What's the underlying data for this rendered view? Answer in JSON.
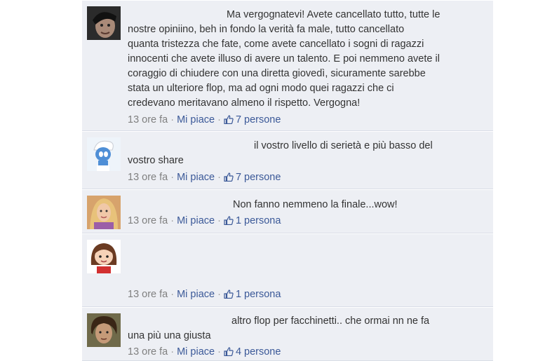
{
  "comments": [
    {
      "avatar": "avatar-man-dark-hair",
      "lines": [
        "Ma vergognatevi! Avete cancellato tutto, tutte le",
        "nostre opiniino, beh in fondo la verità fa male, tutto cancellato",
        "quanta tristezza che fate, come avete cancellato i sogni di ragazzi",
        "innocenti che avete illuso di avere un talento. E poi nemmeno avete il",
        "coraggio di chiudere con una diretta giovedì, sicuramente sarebbe",
        "stata un ulteriore flop, ma ad ogni modo quei ragazzi che ci",
        "credevano meritavano almeno il rispetto. Vergogna!"
      ],
      "time": "13 ore fa",
      "like_label": "Mi piace",
      "likes": "7 persone"
    },
    {
      "avatar": "avatar-smurf",
      "lines": [
        "il vostro livello di serietà e più basso del",
        "vostro share"
      ],
      "time": "13 ore fa",
      "like_label": "Mi piace",
      "likes": "7 persone"
    },
    {
      "avatar": "avatar-blonde-woman",
      "lines": [
        "Non fanno nemmeno la finale...wow!"
      ],
      "time": "13 ore fa",
      "like_label": "Mi piace",
      "likes": "1 persona"
    },
    {
      "avatar": "avatar-cartoon-girl",
      "lines": [],
      "time": "13 ore fa",
      "like_label": "Mi piace",
      "likes": "1 persona"
    },
    {
      "avatar": "avatar-curly-hair",
      "lines": [
        "altro flop per facchinetti.. che ormai nn ne fa",
        "una più una giusta"
      ],
      "time": "13 ore fa",
      "like_label": "Mi piace",
      "likes": "4 persone"
    }
  ],
  "colors": {
    "background": "#edeff4",
    "link": "#3b5998",
    "meta_text": "#808080",
    "body_text": "#333333"
  }
}
